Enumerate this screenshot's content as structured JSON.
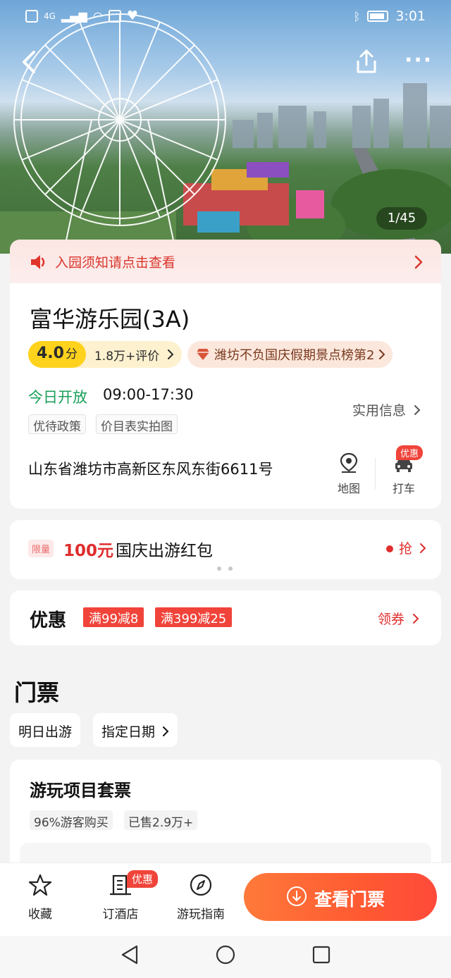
{
  "status_bar": {
    "network": "4G",
    "time": "3:01"
  },
  "gallery": {
    "counter": "1/45"
  },
  "notice": {
    "text": "入园须知请点击查看"
  },
  "attraction": {
    "title": "富华游乐园(3A)",
    "score": "4.0",
    "score_unit": "分",
    "reviews": "1.8万+评价",
    "ranking": "潍坊不负国庆假期景点榜第2",
    "open_label": "今日开放",
    "open_hours": "09:00-17:30",
    "tags": [
      "优待政策",
      "价目表实拍图"
    ],
    "practical_info": "实用信息",
    "address": "山东省潍坊市高新区东风东街6611号",
    "map_label": "地图",
    "taxi_label": "打车",
    "taxi_badge": "优惠"
  },
  "red_packet": {
    "limit_tag": "限量",
    "amount": "100元",
    "rest": "国庆出游红包",
    "grab": "抢"
  },
  "coupons": {
    "heading": "优惠",
    "items": [
      "满99减8",
      "满399减25"
    ],
    "get_label": "领券"
  },
  "tickets": {
    "heading": "门票",
    "date_options": [
      "明日出游",
      "指定日期"
    ],
    "package": {
      "title": "游玩项目套票",
      "tags": [
        "96%游客购买",
        "已售2.9万+"
      ]
    }
  },
  "bottom_bar": {
    "favorite": "收藏",
    "hotel": "订酒店",
    "hotel_badge": "优惠",
    "guide": "游玩指南",
    "cta": "查看门票"
  },
  "colors": {
    "accent_red": "#e02d2d",
    "open_green": "#1aa05a",
    "cta_orange": "#ff5a32",
    "score_yellow": "#ffd21e"
  }
}
